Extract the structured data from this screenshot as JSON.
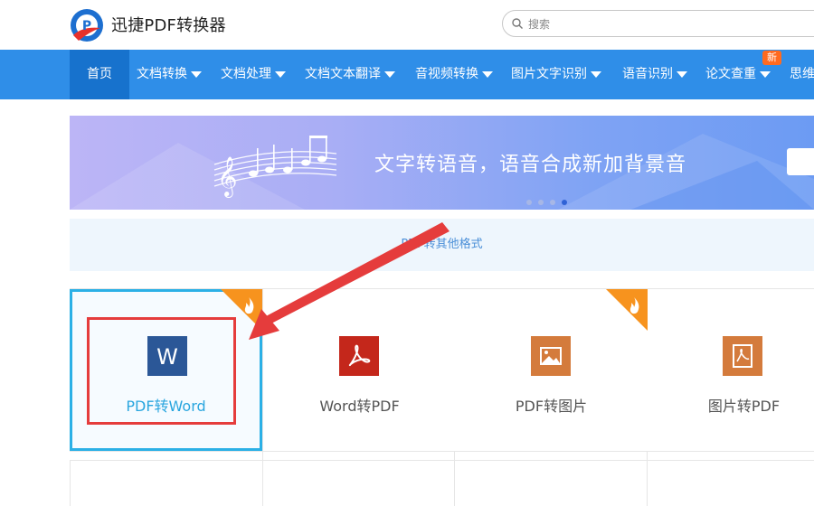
{
  "header": {
    "app_title": "迅捷PDF转换器",
    "search": {
      "placeholder": "搜索",
      "value": ""
    }
  },
  "nav": {
    "items": [
      {
        "label": "首页",
        "active": true,
        "dropdown": false
      },
      {
        "label": "文档转换",
        "dropdown": true
      },
      {
        "label": "文档处理",
        "dropdown": true
      },
      {
        "label": "文档文本翻译",
        "dropdown": true
      },
      {
        "label": "音视频转换",
        "dropdown": true
      },
      {
        "label": "图片文字识别",
        "dropdown": true
      },
      {
        "label": "语音识别",
        "dropdown": true
      },
      {
        "label": "论文查重",
        "dropdown": true,
        "badge": "新"
      },
      {
        "label": "思维",
        "dropdown": false
      }
    ]
  },
  "banner": {
    "text": "文字转语音，语音合成新加背景音",
    "slides": 4,
    "active_slide": 4
  },
  "section": {
    "title": "PDF转其他格式"
  },
  "tools": [
    {
      "label": "PDF转Word",
      "icon": "word-icon",
      "hot": true,
      "selected": true
    },
    {
      "label": "Word转PDF",
      "icon": "pdf-acrobat-icon",
      "hot": false
    },
    {
      "label": "PDF转图片",
      "icon": "image-icon",
      "hot": true
    },
    {
      "label": "图片转PDF",
      "icon": "pdf-acrobat-icon",
      "hot": false
    }
  ],
  "colors": {
    "nav_bg": "#2f8ee8",
    "nav_active_bg": "#1772cd",
    "badge": "#ff6a1f",
    "selected_border": "#2bb0e6",
    "annotation_red": "#e53c3c",
    "word_blue": "#2b5797",
    "pdf_red": "#c4271b",
    "image_orange": "#d47b3c"
  }
}
